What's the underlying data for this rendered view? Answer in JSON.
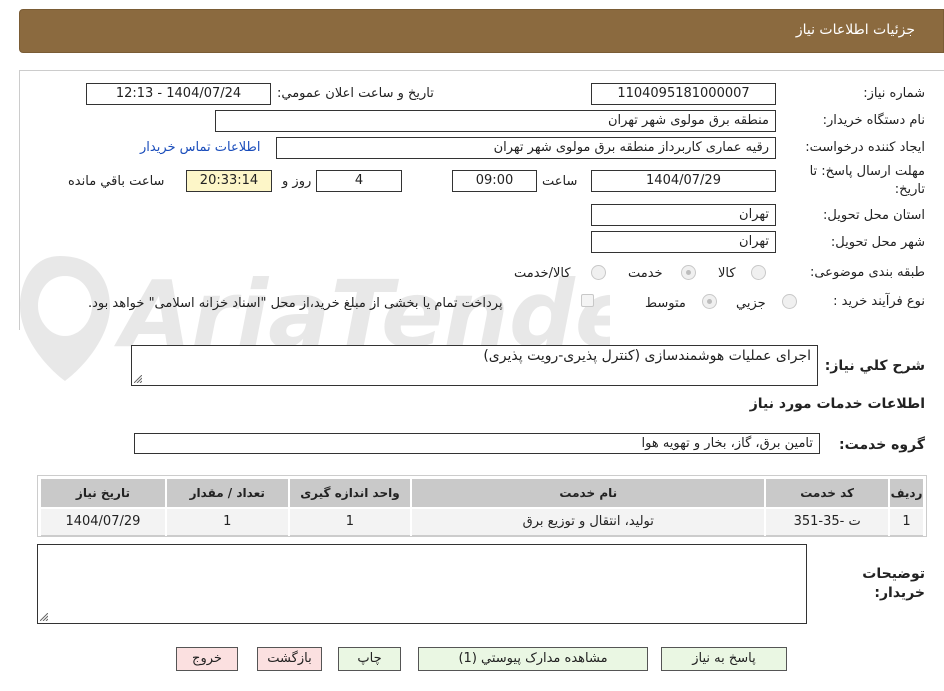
{
  "header": {
    "title": "جزئیات اطلاعات نیاز"
  },
  "form": {
    "need_number_label": "شماره نیاز:",
    "need_number": "1104095181000007",
    "announce_label": "تاریخ و ساعت اعلان عمومي:",
    "announce_value": "1404/07/24 - 12:13",
    "buyer_org_label": "نام دستگاه خریدار:",
    "buyer_org": "منطقه برق مولوی شهر تهران",
    "requester_label": "ایجاد کننده درخواست:",
    "requester": "رقیه عماری کاربرداز منطقه برق مولوی شهر تهران",
    "contact_link": "اطلاعات تماس خریدار",
    "deadline_label_1": "مهلت ارسال پاسخ: تا",
    "deadline_label_2": "تاریخ:",
    "deadline_date": "1404/07/29",
    "time_label": "ساعت",
    "deadline_time": "09:00",
    "days": "4",
    "days_label": "روز و",
    "remaining_time": "20:33:14",
    "remaining_label": "ساعت باقي مانده",
    "province_label": "استان محل تحویل:",
    "province": "تهران",
    "city_label": "شهر محل تحویل:",
    "city": "تهران",
    "category_label": "طبقه بندی موضوعی:",
    "category_options": [
      "کالا",
      "خدمت",
      "کالا/خدمت"
    ],
    "category_selected": "خدمت",
    "process_label": "نوع فرآیند خرید :",
    "process_options": [
      "جزيي",
      "متوسط"
    ],
    "process_selected": "متوسط",
    "payment_note": "پرداخت تمام یا بخشی از مبلغ خرید،از محل \"اسناد خزانه اسلامی\" خواهد بود."
  },
  "watermark": {
    "text": "AriaTender.neT"
  },
  "description": {
    "label": "شرح کلي نیاز:",
    "value": "اجرای عملیات هوشمندسازی (کنترل پذیری-رویت پذیری)"
  },
  "services": {
    "section_title": "اطلاعات خدمات مورد نیاز",
    "group_label": "گروه خدمت:",
    "group_value": "تامین برق، گاز، بخار و تهویه هوا",
    "columns": [
      "ردیف",
      "کد خدمت",
      "نام خدمت",
      "واحد اندازه گیری",
      "تعداد / مقدار",
      "تاریخ نیاز"
    ],
    "rows": [
      [
        "1",
        "ت -35-351",
        "تولید، انتقال و توزیع برق",
        "1",
        "1",
        "1404/07/29"
      ]
    ]
  },
  "notes": {
    "label_1": "توضیحات",
    "label_2": "خریدار:",
    "value": ""
  },
  "buttons": {
    "reply": "پاسخ به نیاز",
    "view_docs": "مشاهده مدارک پیوستي (1)",
    "print": "چاپ",
    "back": "بازگشت",
    "exit": "خروج"
  }
}
